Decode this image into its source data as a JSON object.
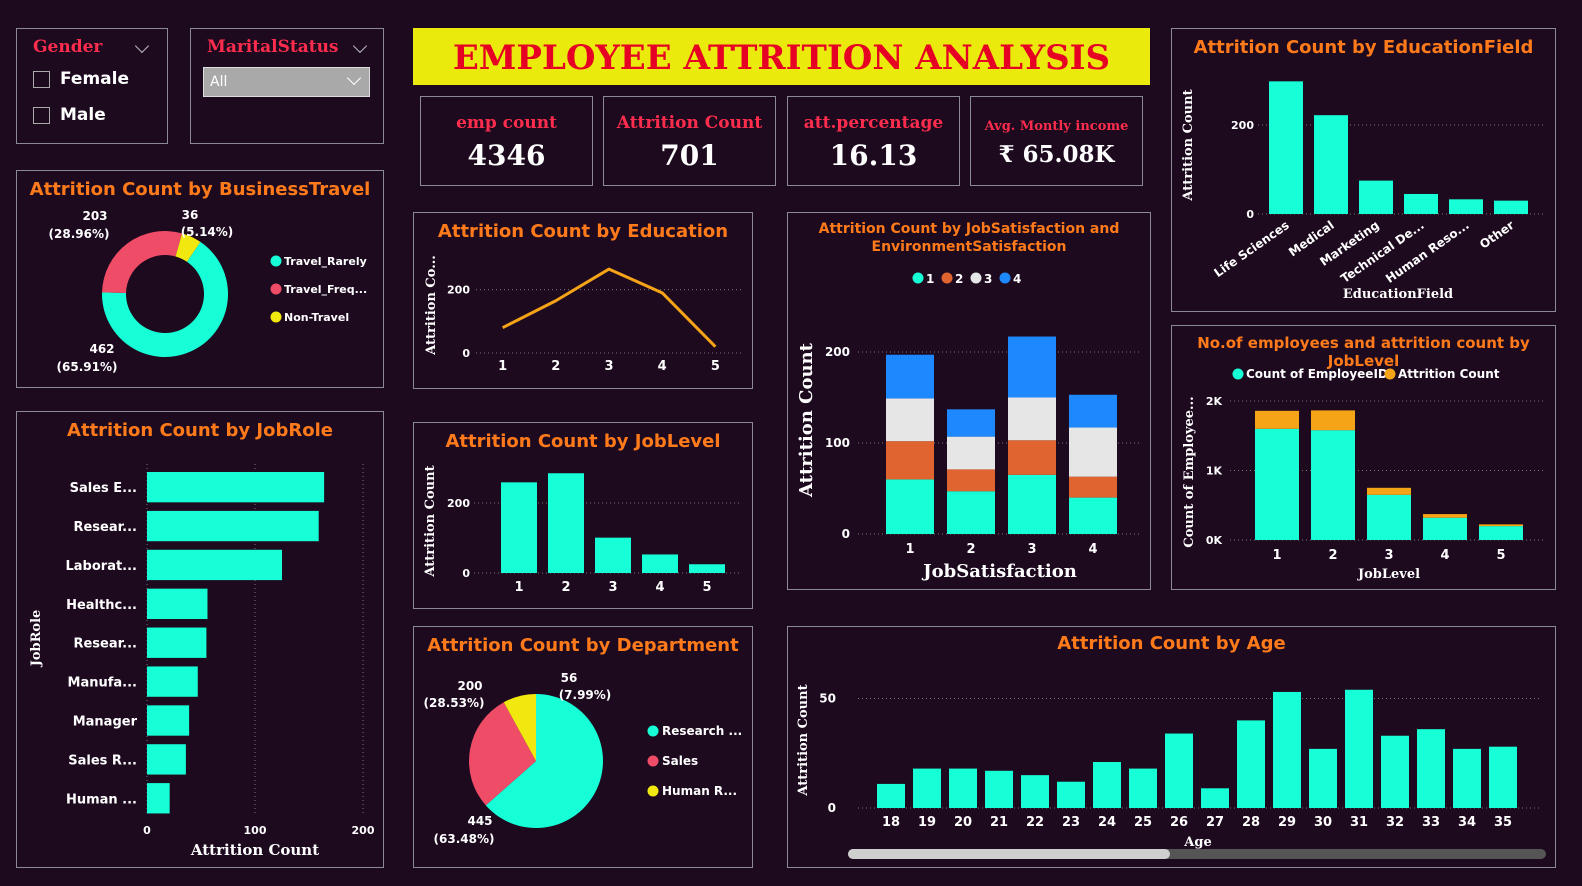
{
  "title": "EMPLOYEE ATTRITION ANALYSIS",
  "colors": {
    "teal": "#17ffd6",
    "pink": "#ee4c67",
    "yellow": "#f0e80e",
    "orange": "#f5a317",
    "blue": "#1e88ff",
    "coral": "#e06430",
    "light": "#e6e6e6",
    "title_orange": "#ff7a1a",
    "kpi_red": "#ff2d4d"
  },
  "slicers": {
    "gender": {
      "title": "Gender",
      "options": [
        "Female",
        "Male"
      ]
    },
    "marital": {
      "title": "MaritalStatus",
      "selected": "All"
    }
  },
  "kpis": [
    {
      "label": "emp count",
      "value": "4346"
    },
    {
      "label": "Attrition Count",
      "value": "701"
    },
    {
      "label": "att.percentage",
      "value": "16.13"
    },
    {
      "label": "Avg. Montly income",
      "value": "₹ 65.08K"
    }
  ],
  "charts": {
    "business_travel": {
      "title": "Attrition Count by BusinessTravel",
      "chart_data": {
        "type": "pie",
        "donut": true,
        "labels": [
          "Travel_Rarely",
          "Travel_Frequently",
          "Non-Travel"
        ],
        "legend_labels": [
          "Travel_Rarely",
          "Travel_Freq...",
          "Non-Travel"
        ],
        "values": [
          462,
          203,
          36
        ],
        "data_labels": [
          "462",
          "(65.91%)",
          "203",
          "(28.96%)",
          "36",
          "(5.14%)"
        ],
        "colors": [
          "#17ffd6",
          "#ee4c67",
          "#f0e80e"
        ]
      }
    },
    "education": {
      "title": "Attrition Count by Education",
      "chart_data": {
        "type": "line",
        "x": [
          "1",
          "2",
          "3",
          "4",
          "5"
        ],
        "values": [
          80,
          165,
          265,
          190,
          20
        ],
        "ylabel": "Attrition Co...",
        "yticks": [
          "0",
          "200"
        ],
        "ylim": [
          0,
          300
        ],
        "color": "#f5a317"
      }
    },
    "job_satisfaction": {
      "title_line1": "Attrition Count by JobSatisfaction and",
      "title_line2": "EnvironmentSatisfaction",
      "chart_data": {
        "type": "bar",
        "stacked": true,
        "categories": [
          "1",
          "2",
          "3",
          "4"
        ],
        "series": [
          {
            "name": "1",
            "values": [
              60,
              47,
              65,
              40
            ],
            "color": "#17ffd6"
          },
          {
            "name": "2",
            "values": [
              42,
              24,
              38,
              23
            ],
            "color": "#e06430"
          },
          {
            "name": "3",
            "values": [
              47,
              36,
              47,
              54
            ],
            "color": "#e6e6e6"
          },
          {
            "name": "4",
            "values": [
              48,
              30,
              67,
              36
            ],
            "color": "#1e88ff"
          }
        ],
        "xlabel": "JobSatisfaction",
        "ylabel": "Attrition Count",
        "yticks": [
          "0",
          "100",
          "200"
        ],
        "ylim": [
          0,
          200
        ]
      }
    },
    "education_field": {
      "title": "Attrition Count by EducationField",
      "chart_data": {
        "type": "bar",
        "categories": [
          "Life Sciences",
          "Medical",
          "Marketing",
          "Technical De...",
          "Human Reso...",
          "Other"
        ],
        "values": [
          298,
          222,
          75,
          45,
          33,
          30
        ],
        "xlabel": "EducationField",
        "ylabel": "Attrition Count",
        "yticks": [
          "0",
          "200"
        ],
        "ylim": [
          0,
          310
        ],
        "color": "#17ffd6"
      }
    },
    "job_role": {
      "title": "Attrition Count by JobRole",
      "chart_data": {
        "type": "bar",
        "orientation": "horizontal",
        "categories": [
          "Sales E...",
          "Resear...",
          "Laborat...",
          "Healthc...",
          "Resear...",
          "Manufa...",
          "Manager",
          "Sales R...",
          "Human ..."
        ],
        "values": [
          164,
          159,
          125,
          56,
          55,
          47,
          39,
          36,
          21
        ],
        "xlabel": "Attrition Count",
        "ylabel": "JobRole",
        "xticks": [
          "0",
          "100",
          "200"
        ],
        "xlim": [
          0,
          200
        ],
        "color": "#17ffd6"
      }
    },
    "job_level": {
      "title": "Attrition Count by JobLevel",
      "chart_data": {
        "type": "bar",
        "categories": [
          "1",
          "2",
          "3",
          "4",
          "5"
        ],
        "values": [
          259,
          285,
          101,
          53,
          25
        ],
        "ylabel": "Attrition Count",
        "yticks": [
          "0",
          "200"
        ],
        "ylim": [
          0,
          300
        ],
        "color": "#17ffd6"
      }
    },
    "emp_joblevel": {
      "title": "No.of employees and attrition count by JobLevel",
      "chart_data": {
        "type": "bar",
        "stacked": true,
        "categories": [
          "1",
          "2",
          "3",
          "4",
          "5"
        ],
        "series": [
          {
            "name": "Count of EmployeeID",
            "values": [
              1600,
              1580,
              650,
              320,
              200
            ],
            "color": "#17ffd6"
          },
          {
            "name": "Attrition Count",
            "values": [
              259,
              285,
              101,
              53,
              25
            ],
            "color": "#f5a317"
          }
        ],
        "xlabel": "JobLevel",
        "ylabel": "Count of Employee...",
        "yticks": [
          "0K",
          "1K",
          "2K"
        ],
        "ylim": [
          0,
          2000
        ]
      }
    },
    "department": {
      "title": "Attrition Count by Department",
      "chart_data": {
        "type": "pie",
        "labels": [
          "Research & Development",
          "Sales",
          "Human Resources"
        ],
        "legend_labels": [
          "Research ...",
          "Sales",
          "Human R..."
        ],
        "values": [
          445,
          200,
          56
        ],
        "data_labels": [
          "445",
          "(63.48%)",
          "200",
          "(28.53%)",
          "56",
          "(7.99%)"
        ],
        "colors": [
          "#17ffd6",
          "#ee4c67",
          "#f0e80e"
        ]
      }
    },
    "age": {
      "title": "Attrition Count by Age",
      "chart_data": {
        "type": "bar",
        "categories": [
          "18",
          "19",
          "20",
          "21",
          "22",
          "23",
          "24",
          "25",
          "26",
          "27",
          "28",
          "29",
          "30",
          "31",
          "32",
          "33",
          "34",
          "35"
        ],
        "values": [
          11,
          18,
          18,
          17,
          15,
          12,
          21,
          18,
          34,
          9,
          40,
          53,
          27,
          54,
          33,
          36,
          27,
          28
        ],
        "xlabel": "Age",
        "ylabel": "Attrition Count",
        "yticks": [
          "0",
          "50"
        ],
        "ylim": [
          0,
          58
        ],
        "color": "#17ffd6"
      }
    }
  }
}
